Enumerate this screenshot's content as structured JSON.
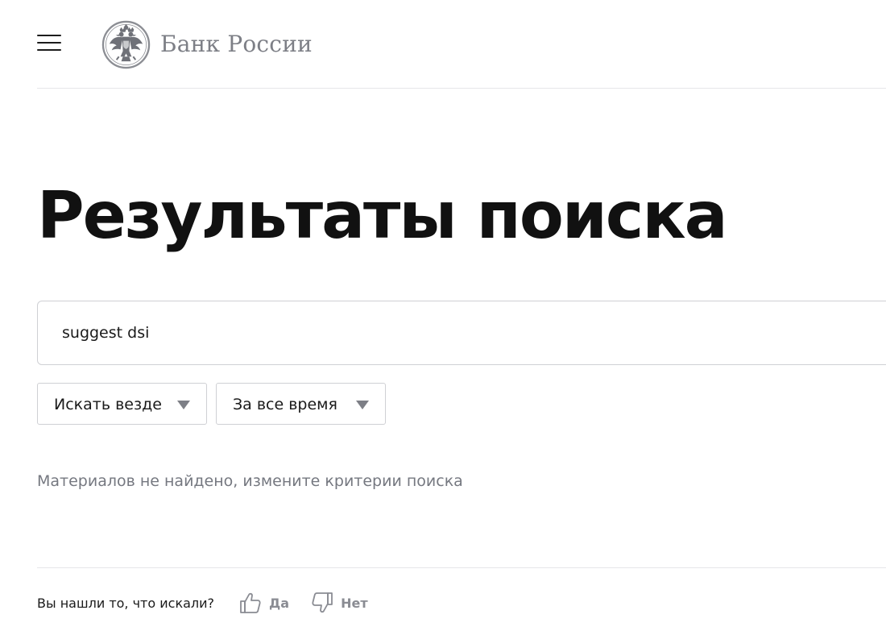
{
  "header": {
    "menu_icon": "hamburger-menu-icon",
    "logo_icon": "double-headed-eagle-emblem-icon",
    "logo_text": "Банк России"
  },
  "main": {
    "title": "Результаты поиска",
    "search": {
      "value": "suggest dsi",
      "placeholder": ""
    },
    "filters": {
      "scope": {
        "selected": "Искать везде",
        "icon": "caret-down-icon"
      },
      "period": {
        "selected": "За все время",
        "icon": "caret-down-icon"
      }
    },
    "no_results_message": "Материалов не найдено, измените критерии поиска"
  },
  "feedback": {
    "question": "Вы нашли то, что искали?",
    "yes": {
      "label": "Да",
      "icon": "thumbs-up-icon"
    },
    "no": {
      "label": "Нет",
      "icon": "thumbs-down-icon"
    }
  },
  "colors": {
    "text_primary": "#111111",
    "text_muted": "#757880",
    "logo_grey": "#7d7f86",
    "border": "#cfd0d4",
    "divider": "#e6e6e9",
    "feedback_label": "#8a8c93"
  }
}
